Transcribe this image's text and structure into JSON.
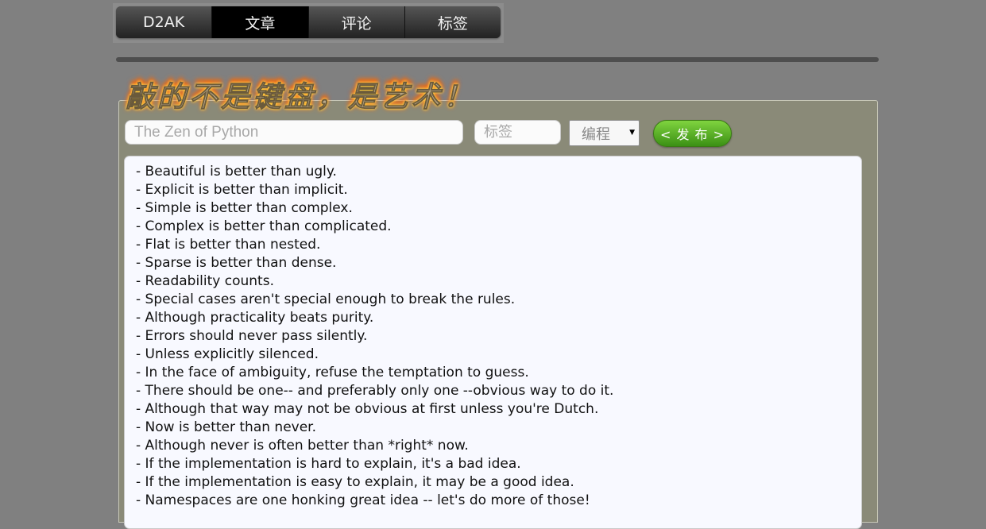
{
  "nav": {
    "items": [
      {
        "label": "D2AK",
        "active": false
      },
      {
        "label": "文章",
        "active": true
      },
      {
        "label": "评论",
        "active": false
      },
      {
        "label": "标签",
        "active": false
      }
    ]
  },
  "banner": {
    "text": "敲的不是键盘，是艺术！"
  },
  "editor": {
    "title_placeholder": "The Zen of Python",
    "tag_placeholder": "标签",
    "category_selected": "编程",
    "publish_label": "< 发 布 >",
    "content_lines": [
      "- Beautiful is better than ugly.",
      "- Explicit is better than implicit.",
      "- Simple is better than complex.",
      "- Complex is better than complicated.",
      "- Flat is better than nested.",
      "- Sparse is better than dense.",
      "- Readability counts.",
      "- Special cases aren't special enough to break the rules.",
      "- Although practicality beats purity.",
      "- Errors should never pass silently.",
      "- Unless explicitly silenced.",
      "- In the face of ambiguity, refuse the temptation to guess.",
      "- There should be one-- and preferably only one --obvious way to do it.",
      "- Although that way may not be obvious at first unless you're Dutch.",
      "- Now is better than never.",
      "- Although never is often better than *right* now.",
      "- If the implementation is hard to explain, it's a bad idea.",
      "- If the implementation is easy to explain, it may be a good idea.",
      "- Namespaces are one honking great idea -- let's do more of those!"
    ]
  },
  "colors": {
    "page_background": "#808080",
    "nav_active": "#000000",
    "panel_background": "#8a8a78",
    "publish_button": "#5aae28",
    "banner_fire": "#ff7a00"
  }
}
